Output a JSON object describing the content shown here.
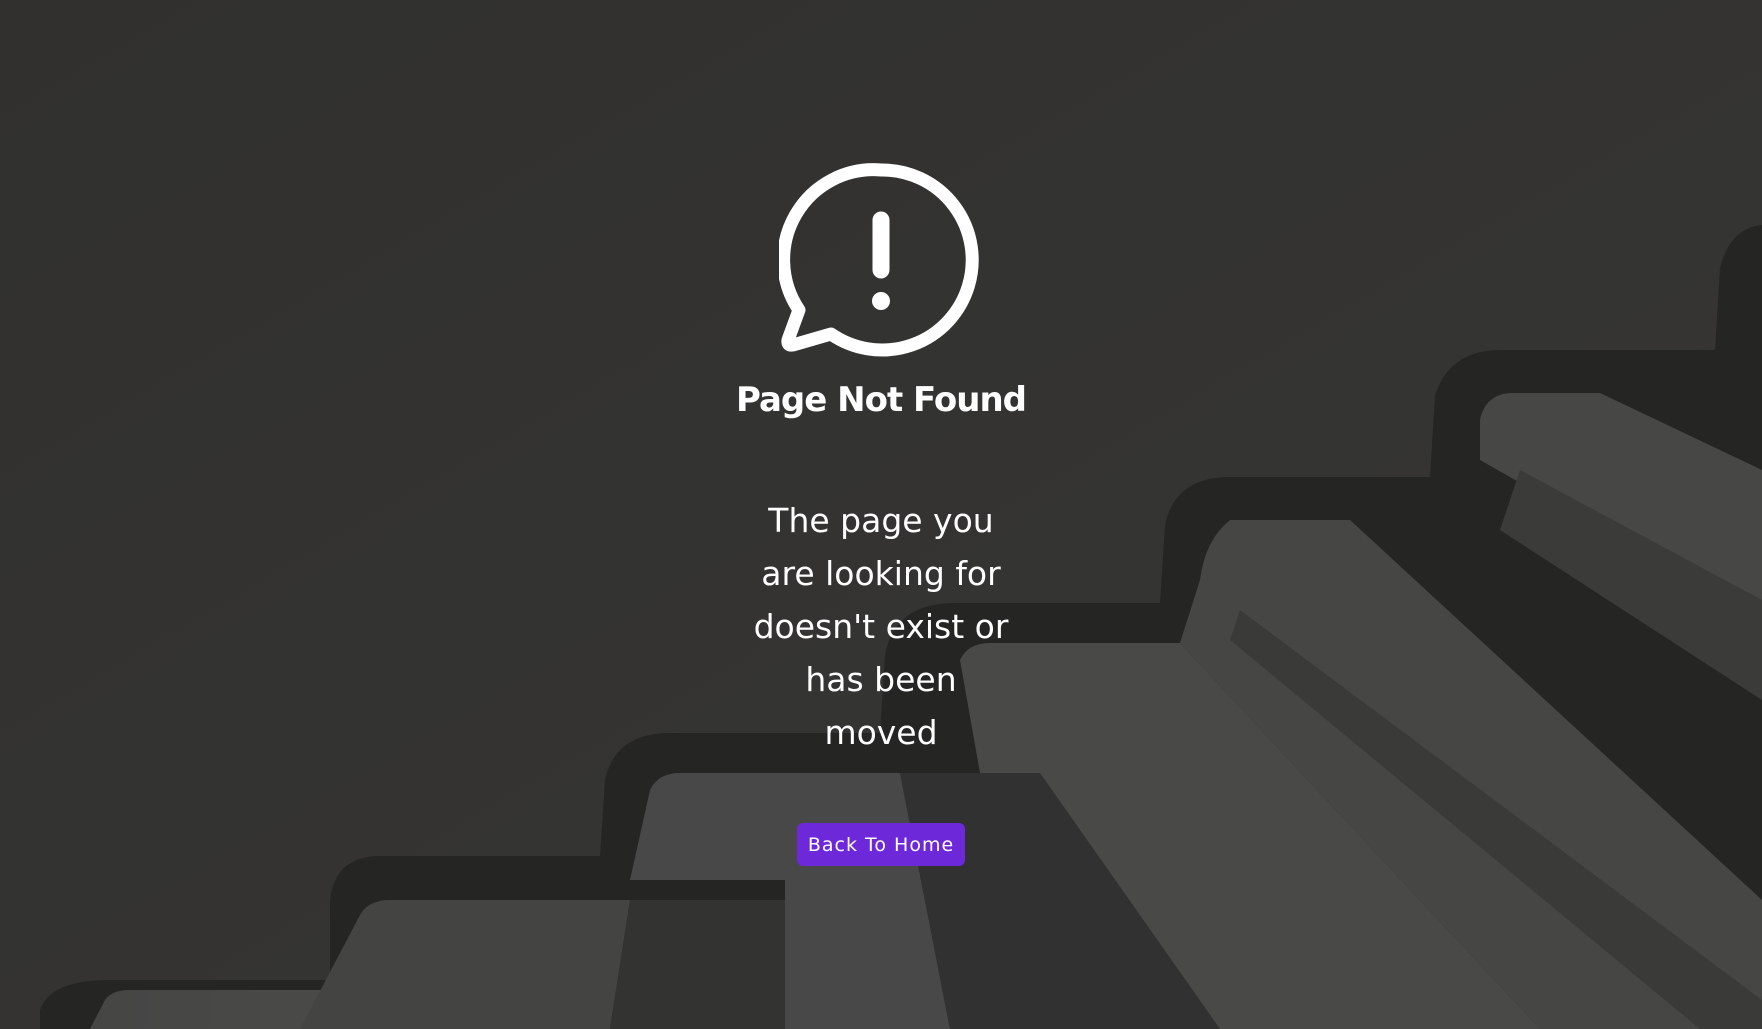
{
  "not_found": {
    "icon": "alert-speech-bubble-icon",
    "title": "Page Not Found",
    "message": "The page you are looking for doesn't exist or has been moved",
    "button_label": "Back To Home"
  },
  "colors": {
    "background": "#3a3a39",
    "text": "#ffffff",
    "button": "#6d28d9"
  }
}
